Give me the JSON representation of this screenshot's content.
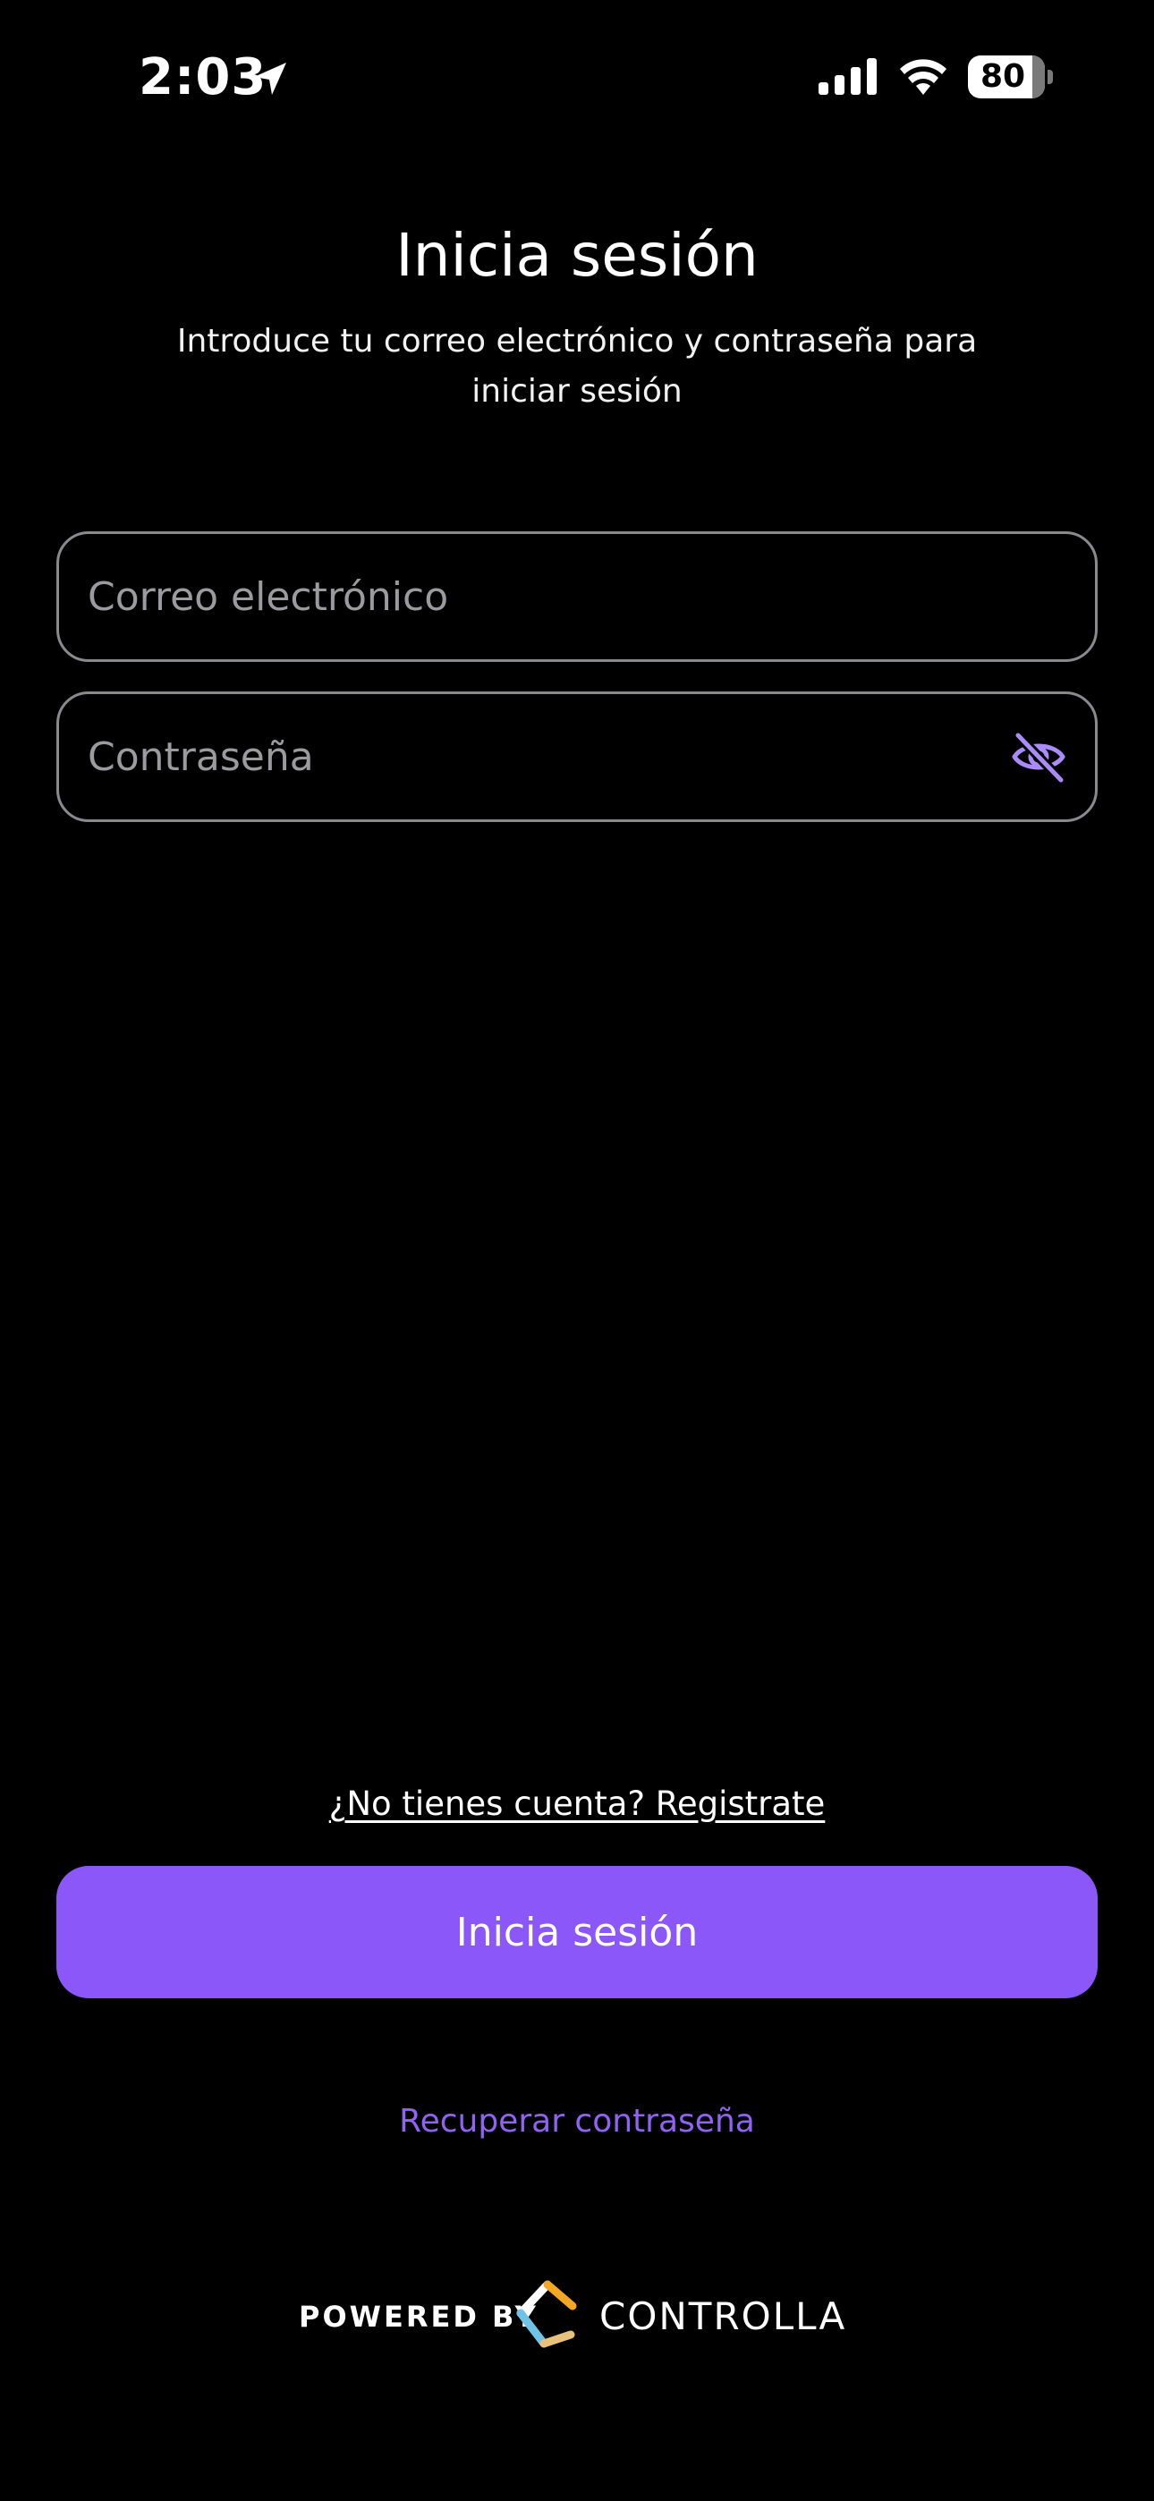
{
  "status_bar": {
    "time": "2:03",
    "battery": "80",
    "icons": [
      "location-arrow-icon",
      "cellular-signal-icon",
      "wifi-icon",
      "battery-icon"
    ]
  },
  "header": {
    "title": "Inicia sesión",
    "subtitle": "Introduce tu correo electrónico y contraseña para iniciar sesión"
  },
  "form": {
    "email": {
      "value": "",
      "placeholder": "Correo electrónico"
    },
    "password": {
      "value": "",
      "placeholder": "Contraseña",
      "toggle_icon": "eye-slash-icon"
    }
  },
  "actions": {
    "register_link": "¿No tienes cuenta? Registrate",
    "login_button": "Inicia sesión",
    "recover_link": "Recuperar contraseña"
  },
  "footer": {
    "powered_by": "POWERED BY",
    "brand": "CONTROLLA"
  },
  "colors": {
    "background": "#000000",
    "accent": "#8b57f9",
    "link_accent": "#9063f4",
    "field_border": "#8a8a8e",
    "placeholder": "#9b9b9f"
  }
}
